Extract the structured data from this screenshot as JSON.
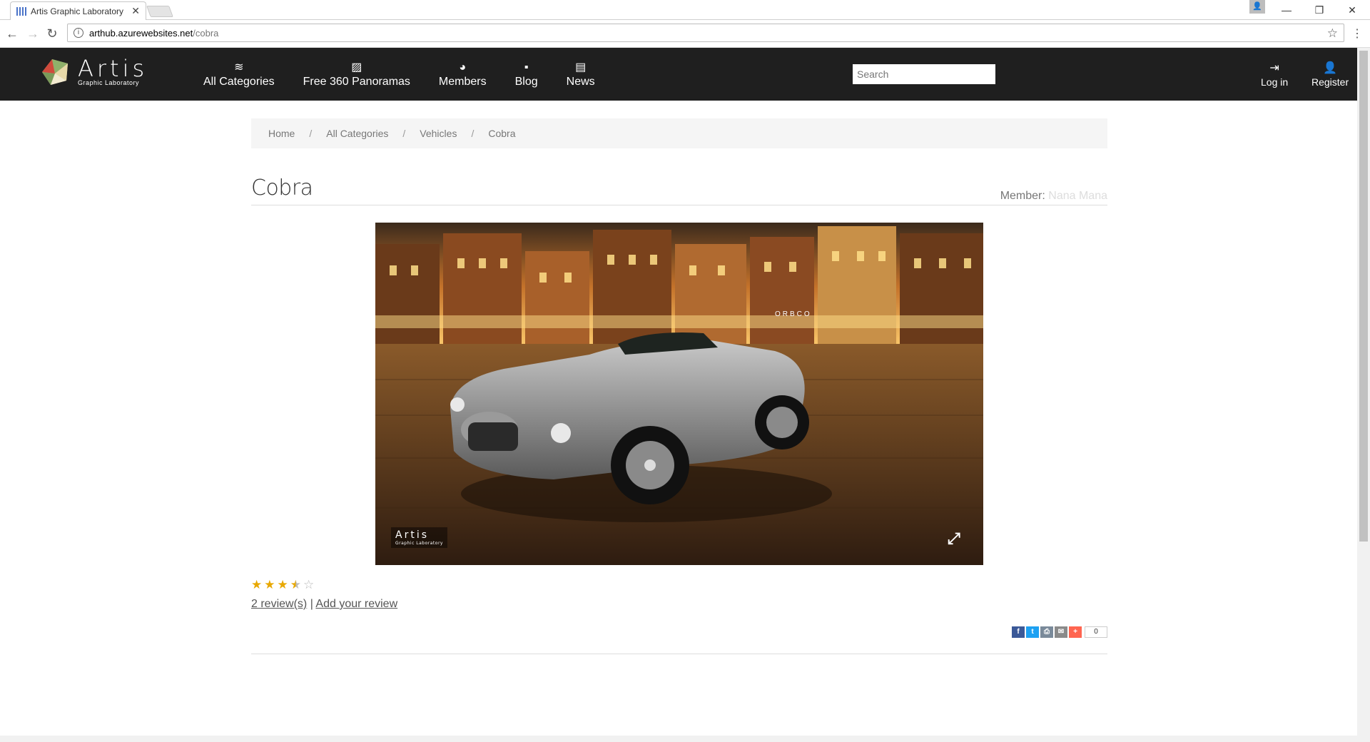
{
  "browser": {
    "tab_title": "Artis Graphic Laboratory",
    "url_host": "arthub.azurewebsites.net",
    "url_path": "/cobra"
  },
  "header": {
    "logo_title": "Artis",
    "logo_subtitle": "Graphic Laboratory",
    "nav": [
      {
        "label": "All Categories",
        "icon": "layers-icon"
      },
      {
        "label": "Free 360 Panoramas",
        "icon": "image-icon"
      },
      {
        "label": "Members",
        "icon": "members-icon"
      },
      {
        "label": "Blog",
        "icon": "comment-icon"
      },
      {
        "label": "News",
        "icon": "newspaper-icon"
      }
    ],
    "search_placeholder": "Search",
    "login_label": "Log in",
    "register_label": "Register"
  },
  "breadcrumb": [
    "Home",
    "All Categories",
    "Vehicles",
    "Cobra"
  ],
  "page": {
    "title": "Cobra",
    "member_label": "Member:",
    "member_name": "Nana Mana"
  },
  "viewer": {
    "watermark": "Artis",
    "watermark_sub": "Graphic Laboratory",
    "storefront_sign": "ORBCO"
  },
  "rating": {
    "value": 3.5,
    "max": 5
  },
  "reviews": {
    "count_label": "2 review(s)",
    "separator": "|",
    "add_label": "Add your review"
  },
  "share": {
    "count": "0"
  }
}
